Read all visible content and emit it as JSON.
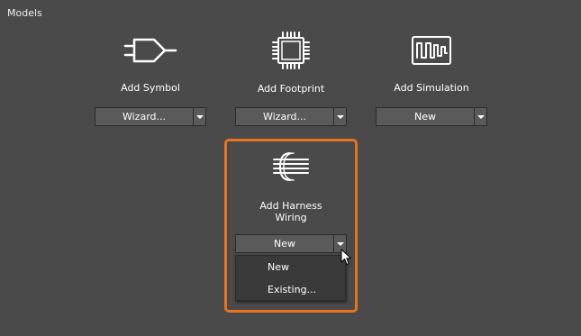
{
  "section": {
    "title": "Models"
  },
  "models": [
    {
      "label": "Add Symbol",
      "combo_value": "Wizard...",
      "icon": "symbol-icon"
    },
    {
      "label": "Add Footprint",
      "combo_value": "Wizard...",
      "icon": "footprint-icon"
    },
    {
      "label": "Add Simulation",
      "combo_value": "New",
      "icon": "simulation-icon"
    }
  ],
  "harness": {
    "label_line1": "Add Harness",
    "label_line2": "Wiring",
    "combo_value": "New",
    "icon": "harness-wiring-icon",
    "menu": [
      {
        "label": "New"
      },
      {
        "label": "Existing..."
      }
    ]
  },
  "colors": {
    "background": "#4a4a4a",
    "highlight": "#e8731f",
    "combo": "#5a5a5a",
    "menu": "#3a3a3a"
  }
}
